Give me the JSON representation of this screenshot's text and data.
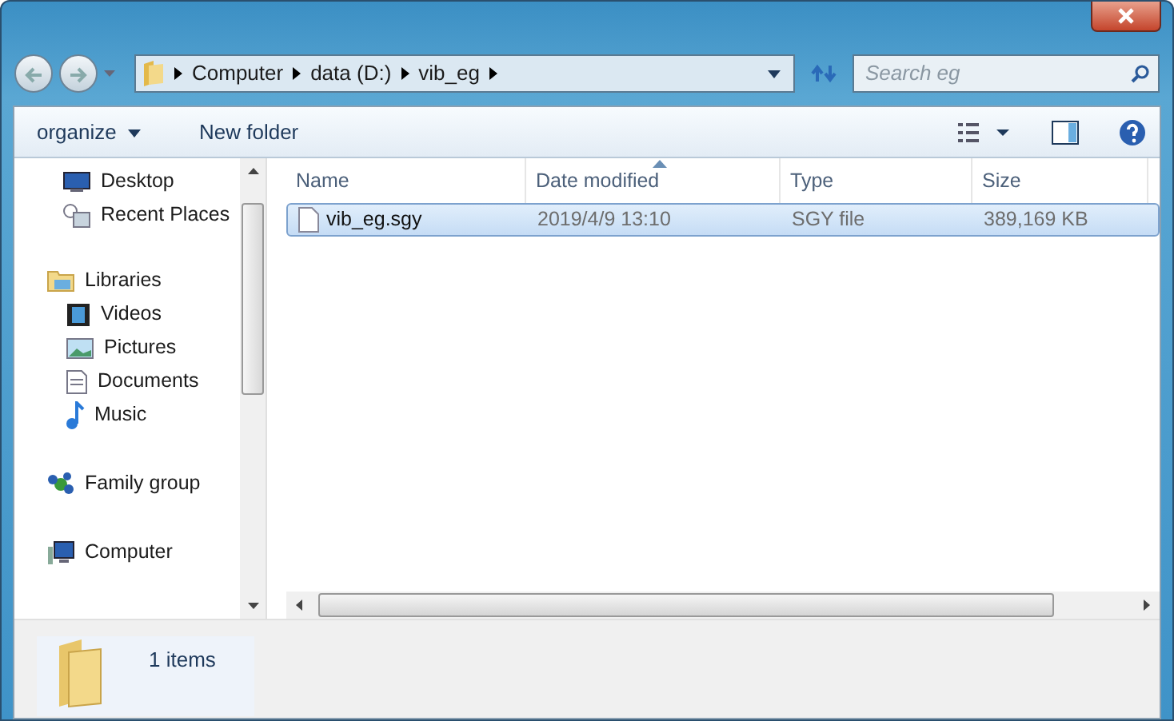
{
  "address_bar": {
    "crumbs": [
      "Computer",
      "data (D:)",
      "vib_eg"
    ]
  },
  "search": {
    "placeholder": "Search eg"
  },
  "toolbar": {
    "buttons": [
      "organize",
      "New folder"
    ]
  },
  "nav_pane": {
    "groups": [
      {
        "children": [
          {
            "label": "Desktop"
          },
          {
            "label": "Recent Places"
          }
        ]
      },
      {
        "label": "Libraries",
        "children": [
          {
            "label": "Videos"
          },
          {
            "label": "Pictures"
          },
          {
            "label": "Documents"
          },
          {
            "label": "Music"
          }
        ]
      },
      {
        "label": "Family group"
      },
      {
        "label": "Computer"
      }
    ]
  },
  "file_list": {
    "columns": [
      {
        "label": "Name",
        "sorted": false
      },
      {
        "label": "Date modified",
        "sorted": true
      },
      {
        "label": "Type",
        "sorted": false
      },
      {
        "label": "Size",
        "sorted": false
      }
    ],
    "rows": [
      {
        "name": "vib_eg.sgy",
        "date": "2019/4/9 13:10",
        "type": "SGY file",
        "size": "389,169 KB",
        "selected": true
      }
    ]
  },
  "details_pane": {
    "text": "1 items"
  }
}
